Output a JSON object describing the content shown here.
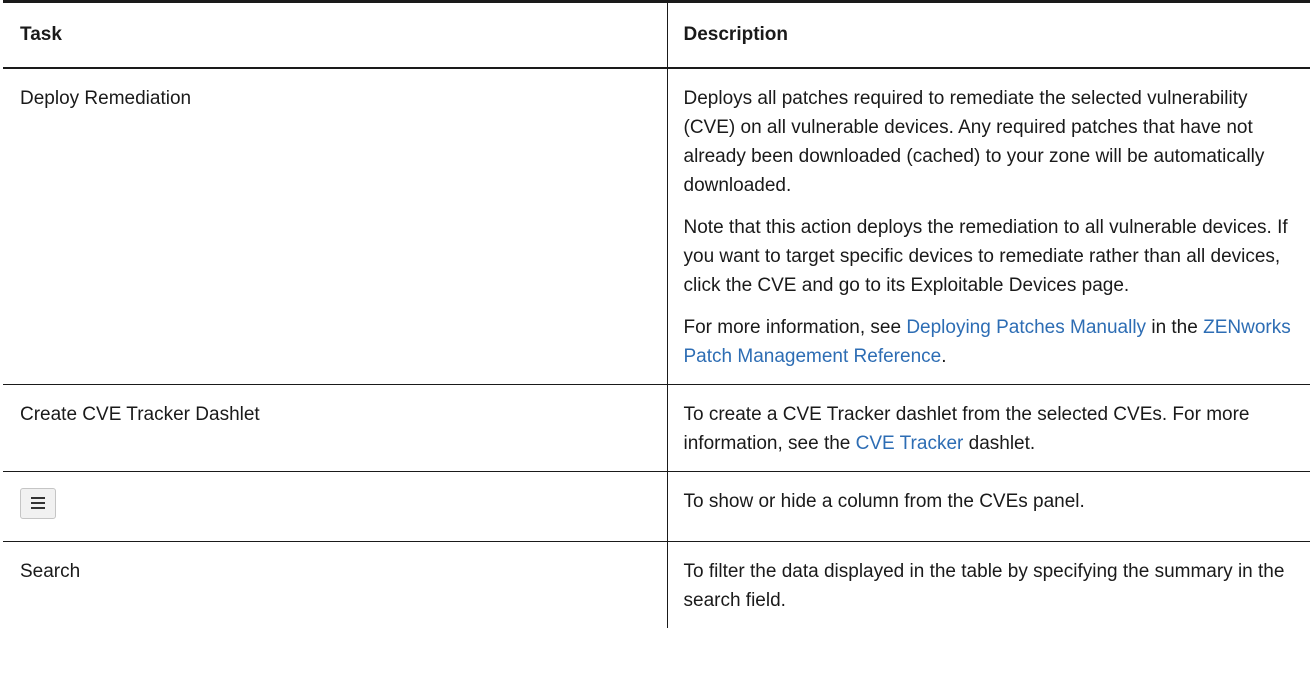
{
  "header": {
    "task": "Task",
    "description": "Description"
  },
  "rows": [
    {
      "task": "Deploy Remediation",
      "p1": "Deploys all patches required to remediate the selected vulnerability (CVE) on all vulnerable devices. Any required patches that have not already been downloaded (cached) to your zone will be automatically downloaded.",
      "p2": "Note that this action deploys the remediation to all vulnerable devices. If you want to target specific devices to remediate rather than all devices, click the CVE and go to its Exploitable Devices page.",
      "p3_pre": "For more information, see ",
      "p3_link1": "Deploying Patches Manually",
      "p3_mid": " in the ",
      "p3_link2": "ZENworks Patch Management Reference",
      "p3_post": "."
    },
    {
      "task": "Create CVE Tracker Dashlet",
      "d_pre": "To create a CVE Tracker dashlet from the selected CVEs. For more information, see the ",
      "d_link": "CVE Tracker",
      "d_post": " dashlet."
    },
    {
      "task_icon": "menu-icon",
      "description": "To show or hide a column from the CVEs panel."
    },
    {
      "task": "Search",
      "description": "To filter the data displayed in the table by specifying the summary in the search field."
    }
  ]
}
